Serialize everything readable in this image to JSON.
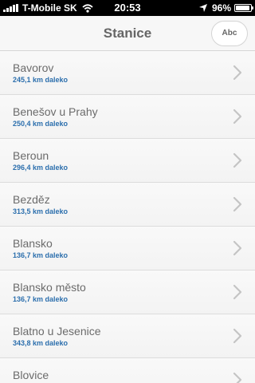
{
  "status_bar": {
    "carrier": "T-Mobile SK",
    "time": "20:53",
    "battery_percent": "96%",
    "battery_level": 0.96,
    "signal_icon": "signal-bars-icon",
    "wifi_icon": "wifi-icon",
    "location_icon": "location-arrow-icon"
  },
  "nav": {
    "title": "Stanice",
    "abc_label": "Abc"
  },
  "stations": [
    {
      "name": "Bavorov",
      "distance": "245,1 km daleko"
    },
    {
      "name": "Benešov u Prahy",
      "distance": "250,4 km daleko"
    },
    {
      "name": "Beroun",
      "distance": "296,4 km daleko"
    },
    {
      "name": "Bezděz",
      "distance": "313,5 km daleko"
    },
    {
      "name": "Blansko",
      "distance": "136,7 km daleko"
    },
    {
      "name": "Blansko město",
      "distance": "136,7 km daleko"
    },
    {
      "name": "Blatno u Jesenice",
      "distance": "343,8 km daleko"
    },
    {
      "name": "Blovice",
      "distance": ""
    }
  ],
  "colors": {
    "distance_text": "#2c6fad",
    "name_text": "#6b6b6b",
    "title_text": "#666666"
  },
  "icons": {
    "row_chevron": "chevron-right-icon"
  }
}
